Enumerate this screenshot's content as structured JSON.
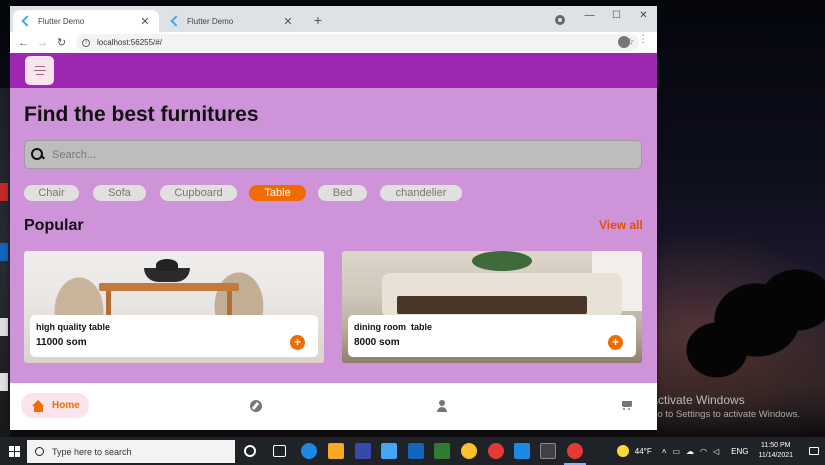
{
  "browser": {
    "tabs": [
      {
        "title": "Flutter Demo",
        "active": true
      },
      {
        "title": "Flutter Demo",
        "active": false
      }
    ],
    "new_tab_symbol": "+",
    "url": "localhost:56255/#/",
    "window_controls": {
      "minimize": "—",
      "maximize": "☐",
      "close": "✕"
    }
  },
  "app": {
    "title": "Find the best furnitures",
    "search_placeholder": "Search...",
    "categories": [
      "Chair",
      "Sofa",
      "Cupboard",
      "Table",
      "Bed",
      "chandelier"
    ],
    "selected_category": "Table",
    "popular_title": "Popular",
    "view_all": "View all",
    "products": [
      {
        "name": "high quality table",
        "price": "11000 som"
      },
      {
        "name": "dining room  table",
        "price": "8000 som"
      }
    ],
    "bottom_nav": {
      "items": [
        {
          "label": "Home",
          "icon": "home-icon",
          "selected": true
        },
        {
          "label": "",
          "icon": "explore-icon"
        },
        {
          "label": "",
          "icon": "person-icon"
        },
        {
          "label": "",
          "icon": "cart-icon"
        }
      ]
    },
    "colors": {
      "appbar": "#9c27b0",
      "background": "#ce93d8",
      "accent": "#ef6c00",
      "chip": "#e0e0e0",
      "home_pill": "#fce4ec"
    }
  },
  "desktop": {
    "activation_title": "Activate Windows",
    "activation_sub": "Go to Settings to activate Windows."
  },
  "taskbar": {
    "search_placeholder": "Type here to search",
    "temperature": "44°F",
    "language": "ENG",
    "time": "11:50 PM",
    "date": "11/14/2021"
  }
}
